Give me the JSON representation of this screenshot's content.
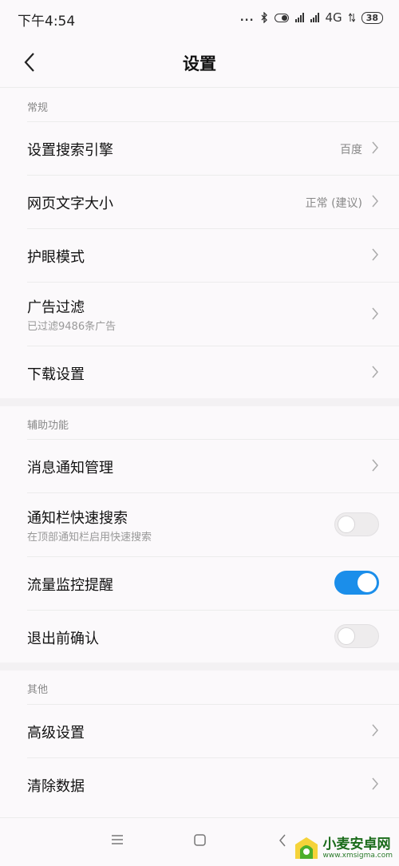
{
  "status_bar": {
    "time": "下午4:54",
    "dots": "...",
    "network": "4G",
    "battery": "38"
  },
  "header": {
    "title": "设置"
  },
  "sections": {
    "general": "常规",
    "assist": "辅助功能",
    "other": "其他"
  },
  "rows": {
    "search_engine": {
      "title": "设置搜索引擎",
      "value": "百度"
    },
    "font_size": {
      "title": "网页文字大小",
      "value": "正常 (建议)"
    },
    "eye_care": {
      "title": "护眼模式"
    },
    "ad_filter": {
      "title": "广告过滤",
      "subtitle": "已过滤9486条广告"
    },
    "download": {
      "title": "下载设置"
    },
    "notify_mgmt": {
      "title": "消息通知管理"
    },
    "quick_search": {
      "title": "通知栏快速搜索",
      "subtitle": "在顶部通知栏启用快速搜索",
      "enabled": false
    },
    "traffic": {
      "title": "流量监控提醒",
      "enabled": true
    },
    "exit_confirm": {
      "title": "退出前确认",
      "enabled": false
    },
    "advanced": {
      "title": "高级设置"
    },
    "clear_data": {
      "title": "清除数据"
    }
  },
  "watermark": {
    "title": "小麦安卓网",
    "url": "www.xmsigma.com"
  },
  "colors": {
    "accent": "#1b8eea",
    "background": "#fbf9fb"
  }
}
